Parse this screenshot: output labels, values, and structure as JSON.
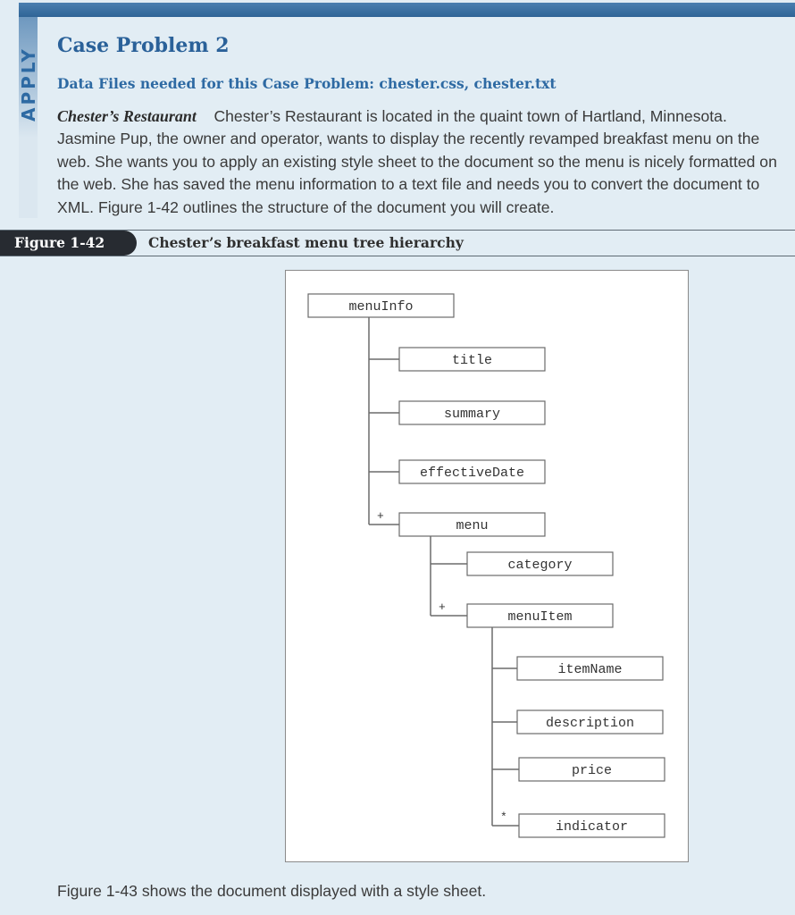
{
  "sidebar": {
    "label": "APPLY",
    "accent_color": "#2e6aa3"
  },
  "header": {
    "title": "Case Problem 2",
    "data_files": "Data Files needed for this Case Problem: chester.css, chester.txt"
  },
  "intro": {
    "lead": "Chester’s Restaurant",
    "body": "Chester’s Restaurant is located in the quaint town of Hartland, Minnesota. Jasmine Pup, the owner and operator, wants to display the recently revamped breakfast menu on the web. She wants you to apply an existing style sheet to the document so the menu is nicely formatted on the web. She has saved the menu information to a text file and needs you to convert the document to XML. Figure 1-42 outlines the structure of the document you will create."
  },
  "figure": {
    "number": "Figure 1-42",
    "caption": "Chester’s breakfast menu tree hierarchy",
    "tree": {
      "nodes": [
        {
          "id": "menuInfo",
          "label": "menuInfo",
          "parent": null,
          "marker": ""
        },
        {
          "id": "title",
          "label": "title",
          "parent": "menuInfo",
          "marker": ""
        },
        {
          "id": "summary",
          "label": "summary",
          "parent": "menuInfo",
          "marker": ""
        },
        {
          "id": "effectiveDate",
          "label": "effectiveDate",
          "parent": "menuInfo",
          "marker": ""
        },
        {
          "id": "menu",
          "label": "menu",
          "parent": "menuInfo",
          "marker": "+"
        },
        {
          "id": "category",
          "label": "category",
          "parent": "menu",
          "marker": ""
        },
        {
          "id": "menuItem",
          "label": "menuItem",
          "parent": "menu",
          "marker": "+"
        },
        {
          "id": "itemName",
          "label": "itemName",
          "parent": "menuItem",
          "marker": ""
        },
        {
          "id": "description",
          "label": "description",
          "parent": "menuItem",
          "marker": ""
        },
        {
          "id": "price",
          "label": "price",
          "parent": "menuItem",
          "marker": ""
        },
        {
          "id": "indicator",
          "label": "indicator",
          "parent": "menuItem",
          "marker": "*"
        }
      ]
    }
  },
  "footer": {
    "text": "Figure 1-43 shows the document displayed with a style sheet."
  }
}
